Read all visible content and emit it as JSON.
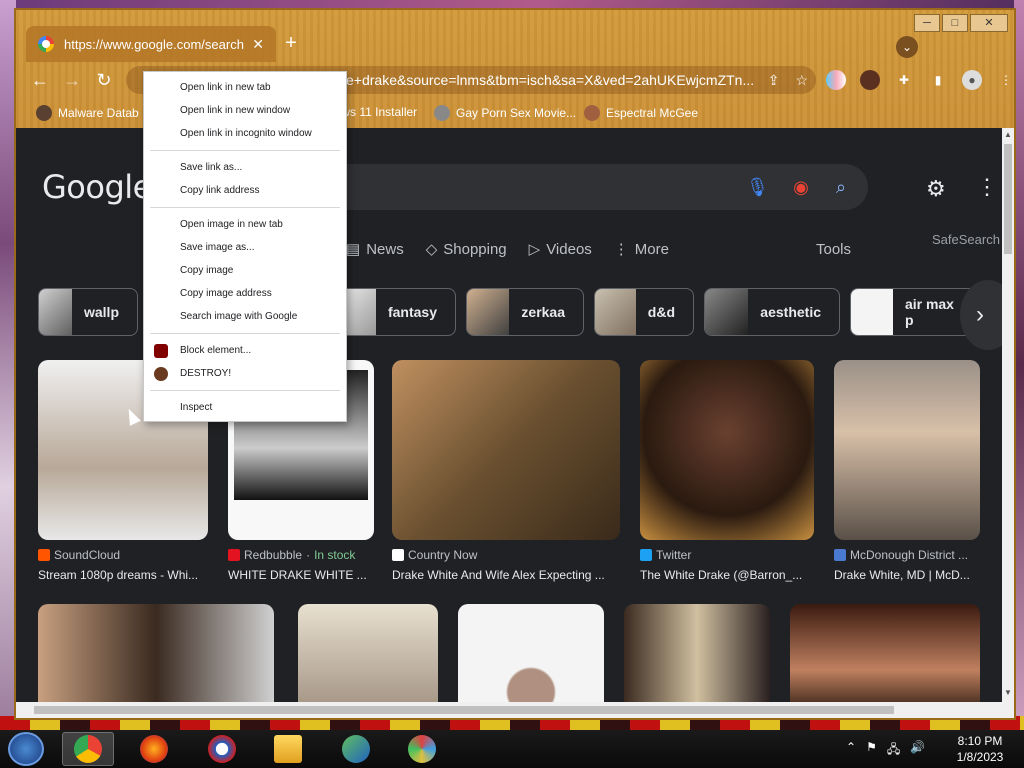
{
  "browser": {
    "tab_title": "https://www.google.com/search?q",
    "tab_close": "✕",
    "new_tab": "+",
    "url_visible": "e+drake&source=lnms&tbm=isch&sa=X&ved=2ahUKEwjcmZTn...",
    "window_controls": [
      "─",
      "□",
      "✕"
    ],
    "bookmarks": [
      "Malware Datab",
      "lows 11 Installer",
      "Gay Porn Sex Movie...",
      "Espectral McGee"
    ]
  },
  "google": {
    "logo": "Google",
    "filters": [
      "News",
      "Shopping",
      "Videos",
      "More"
    ],
    "tools": "Tools",
    "safesearch": "SafeSearch",
    "chips": [
      "wallp",
      "fantasy",
      "zerkaa",
      "d&d",
      "aesthetic",
      "air max p"
    ],
    "results_row1": [
      {
        "source": "SoundCloud",
        "title": "Stream 1080p dreams - Whi...",
        "badge_color": "#ff5500"
      },
      {
        "source": "Redbubble",
        "stock": "In stock",
        "sep": " · ",
        "title": "WHITE DRAKE WHITE ...",
        "badge_color": "#e41321"
      },
      {
        "source": "Country Now",
        "title": "Drake White And Wife Alex Expecting ...",
        "badge_color": "#ffffff"
      },
      {
        "source": "Twitter",
        "title": "The White Drake (@Barron_...",
        "badge_color": "#1da1f2"
      },
      {
        "source": "McDonough District ...",
        "title": "Drake White, MD | McD...",
        "badge_color": "#4a7ad0"
      }
    ]
  },
  "context_menu": {
    "items": [
      "Open link in new tab",
      "Open link in new window",
      "Open link in incognito window",
      "Save link as...",
      "Copy link address",
      "Open image in new tab",
      "Save image as...",
      "Copy image",
      "Copy image address",
      "Search image with Google",
      "Block element...",
      "DESTROY!",
      "Inspect"
    ]
  },
  "taskbar": {
    "time": "8:10 PM",
    "date": "1/8/2023"
  }
}
